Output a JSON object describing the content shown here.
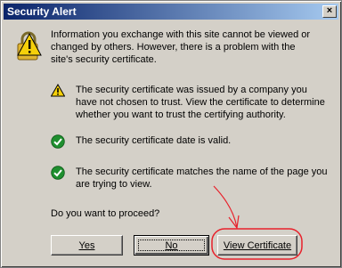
{
  "window": {
    "title": "Security Alert",
    "close_glyph": "×"
  },
  "intro_text": "Information you exchange with this site cannot be viewed or changed by others. However, there is a problem with the site's security certificate.",
  "checks": [
    {
      "icon": "warning-icon",
      "text": "The security certificate was issued by a company you have not chosen to trust. View the certificate to determine whether you want to trust the certifying authority."
    },
    {
      "icon": "check-icon",
      "text": "The security certificate date is valid."
    },
    {
      "icon": "check-icon",
      "text": "The security certificate matches the name of the page you are trying to view."
    }
  ],
  "question": "Do you want to proceed?",
  "buttons": {
    "yes": "Yes",
    "no": "No",
    "view_certificate": "View Certificate"
  },
  "colors": {
    "titlebar_start": "#0a246a",
    "titlebar_end": "#a6caf0",
    "annotation": "#e8202a",
    "check_green": "#1f8f2f",
    "warning_yellow": "#f5d00a"
  }
}
